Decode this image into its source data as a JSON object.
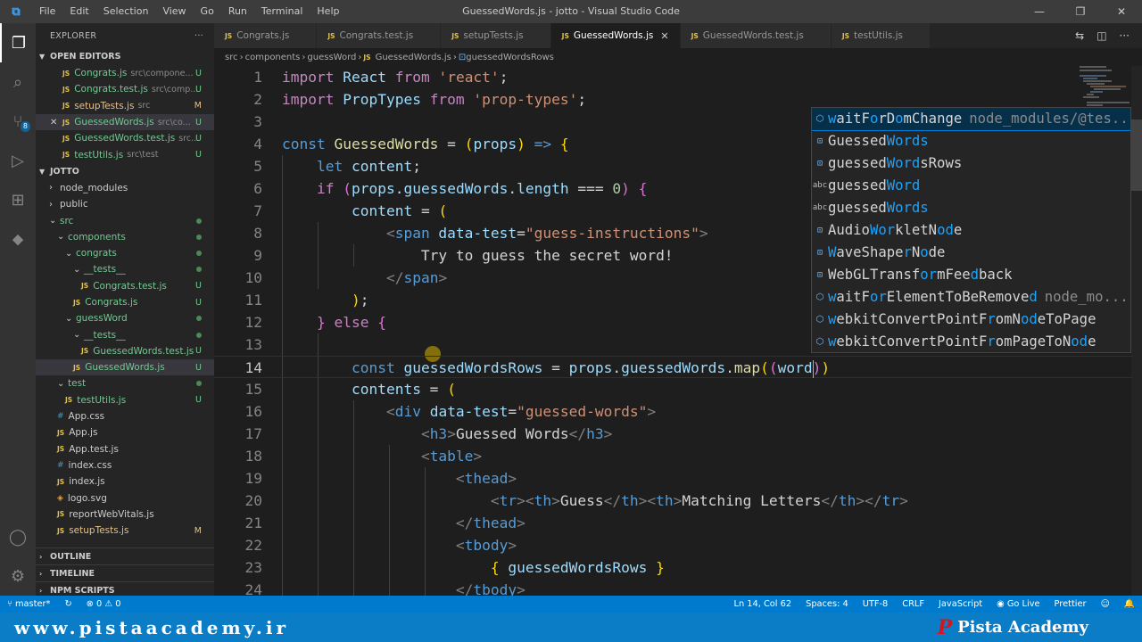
{
  "titlebar": {
    "menu": [
      "File",
      "Edit",
      "Selection",
      "View",
      "Go",
      "Run",
      "Terminal",
      "Help"
    ],
    "title": "GuessedWords.js - jotto - Visual Studio Code"
  },
  "explorer": {
    "title": "EXPLORER",
    "open_editors_label": "OPEN EDITORS",
    "open_editors": [
      {
        "name": "Congrats.js",
        "dir": "src\\compone...",
        "status": "U"
      },
      {
        "name": "Congrats.test.js",
        "dir": "src\\comp...",
        "status": "U"
      },
      {
        "name": "setupTests.js",
        "dir": "src",
        "status": "M"
      },
      {
        "name": "GuessedWords.js",
        "dir": "src\\co...",
        "status": "U"
      },
      {
        "name": "GuessedWords.test.js",
        "dir": "src...",
        "status": "U"
      },
      {
        "name": "testUtils.js",
        "dir": "src\\test",
        "status": "U"
      }
    ],
    "project_label": "JOTTO",
    "tree": [
      {
        "name": "node_modules",
        "type": "folder",
        "indent": 1,
        "open": false
      },
      {
        "name": "public",
        "type": "folder",
        "indent": 1,
        "open": false
      },
      {
        "name": "src",
        "type": "folder",
        "indent": 1,
        "open": true
      },
      {
        "name": "components",
        "type": "folder",
        "indent": 2,
        "open": true
      },
      {
        "name": "congrats",
        "type": "folder",
        "indent": 3,
        "open": true
      },
      {
        "name": "__tests__",
        "type": "folder",
        "indent": 4,
        "open": true
      },
      {
        "name": "Congrats.test.js",
        "type": "js",
        "indent": 5,
        "status": "U"
      },
      {
        "name": "Congrats.js",
        "type": "js",
        "indent": 4,
        "status": "U"
      },
      {
        "name": "guessWord",
        "type": "folder",
        "indent": 3,
        "open": true
      },
      {
        "name": "__tests__",
        "type": "folder",
        "indent": 4,
        "open": true
      },
      {
        "name": "GuessedWords.test.js",
        "type": "js",
        "indent": 5,
        "status": "U"
      },
      {
        "name": "GuessedWords.js",
        "type": "js",
        "indent": 4,
        "status": "U",
        "selected": true
      },
      {
        "name": "test",
        "type": "folder",
        "indent": 2,
        "open": true
      },
      {
        "name": "testUtils.js",
        "type": "js",
        "indent": 3,
        "status": "U"
      },
      {
        "name": "App.css",
        "type": "css",
        "indent": 2
      },
      {
        "name": "App.js",
        "type": "js",
        "indent": 2
      },
      {
        "name": "App.test.js",
        "type": "js",
        "indent": 2
      },
      {
        "name": "index.css",
        "type": "css",
        "indent": 2
      },
      {
        "name": "index.js",
        "type": "js",
        "indent": 2
      },
      {
        "name": "logo.svg",
        "type": "svg",
        "indent": 2
      },
      {
        "name": "reportWebVitals.js",
        "type": "js",
        "indent": 2
      },
      {
        "name": "setupTests.js",
        "type": "js",
        "indent": 2,
        "status": "M"
      }
    ],
    "outline_label": "OUTLINE",
    "timeline_label": "TIMELINE",
    "npm_label": "NPM SCRIPTS"
  },
  "tabs": [
    "Congrats.js",
    "Congrats.test.js",
    "setupTests.js",
    "GuessedWords.js",
    "GuessedWords.test.js",
    "testUtils.js"
  ],
  "active_tab": 3,
  "breadcrumb": [
    "src",
    "components",
    "guessWord",
    "GuessedWords.js",
    "guessedWordsRows"
  ],
  "code": [
    {
      "n": "1",
      "t": [
        [
          "import",
          "c"
        ],
        [
          " React ",
          "v"
        ],
        [
          "from",
          "c"
        ],
        [
          " ",
          ""
        ],
        [
          "'react'",
          "s"
        ],
        [
          ";",
          "p"
        ]
      ]
    },
    {
      "n": "2",
      "t": [
        [
          "import",
          "c"
        ],
        [
          " PropTypes ",
          "v"
        ],
        [
          "from",
          "c"
        ],
        [
          " ",
          ""
        ],
        [
          "'prop-types'",
          "s"
        ],
        [
          ";",
          "p"
        ]
      ]
    },
    {
      "n": "3",
      "t": []
    },
    {
      "n": "4",
      "t": [
        [
          "const",
          "k"
        ],
        [
          " ",
          ""
        ],
        [
          "GuessedWords",
          "f"
        ],
        [
          " = ",
          "p"
        ],
        [
          "(",
          "y"
        ],
        [
          "props",
          "v"
        ],
        [
          ")",
          "y"
        ],
        [
          " => ",
          "k"
        ],
        [
          "{",
          "y"
        ]
      ]
    },
    {
      "n": "5",
      "t": [
        [
          "    ",
          ""
        ],
        [
          "let",
          "k"
        ],
        [
          " content",
          "v"
        ],
        [
          ";",
          "p"
        ]
      ]
    },
    {
      "n": "6",
      "t": [
        [
          "    ",
          ""
        ],
        [
          "if",
          "c"
        ],
        [
          " ",
          ""
        ],
        [
          "(",
          "m"
        ],
        [
          "props",
          "v"
        ],
        [
          ".",
          "p"
        ],
        [
          "guessedWords",
          "v"
        ],
        [
          ".",
          "p"
        ],
        [
          "length",
          "v"
        ],
        [
          " === ",
          "p"
        ],
        [
          "0",
          "n"
        ],
        [
          ")",
          "m"
        ],
        [
          " ",
          ""
        ],
        [
          "{",
          "m"
        ]
      ]
    },
    {
      "n": "7",
      "t": [
        [
          "        ",
          ""
        ],
        [
          "content",
          "v"
        ],
        [
          " = ",
          "p"
        ],
        [
          "(",
          "y"
        ]
      ]
    },
    {
      "n": "8",
      "t": [
        [
          "            ",
          ""
        ],
        [
          "<",
          "g"
        ],
        [
          "span",
          "k"
        ],
        [
          " data-test",
          "v"
        ],
        [
          "=",
          "p"
        ],
        [
          "\"guess-instructions\"",
          "s"
        ],
        [
          ">",
          "g"
        ]
      ]
    },
    {
      "n": "9",
      "t": [
        [
          "                Try to guess the secret word!",
          "p"
        ]
      ]
    },
    {
      "n": "10",
      "t": [
        [
          "            ",
          ""
        ],
        [
          "</",
          "g"
        ],
        [
          "span",
          "k"
        ],
        [
          ">",
          "g"
        ]
      ]
    },
    {
      "n": "11",
      "t": [
        [
          "        ",
          ""
        ],
        [
          ")",
          "y"
        ],
        [
          ";",
          "p"
        ]
      ]
    },
    {
      "n": "12",
      "t": [
        [
          "    ",
          ""
        ],
        [
          "}",
          "m"
        ],
        [
          " ",
          ""
        ],
        [
          "else",
          "c"
        ],
        [
          " ",
          ""
        ],
        [
          "{",
          "m"
        ]
      ]
    },
    {
      "n": "13",
      "t": []
    },
    {
      "n": "14",
      "t": [
        [
          "        ",
          ""
        ],
        [
          "const",
          "k"
        ],
        [
          " ",
          ""
        ],
        [
          "guessedWordsRows",
          "v"
        ],
        [
          " = ",
          "p"
        ],
        [
          "props",
          "v"
        ],
        [
          ".",
          "p"
        ],
        [
          "guessedWords",
          "v"
        ],
        [
          ".",
          "p"
        ],
        [
          "map",
          "f"
        ],
        [
          "(",
          "y"
        ],
        [
          "(",
          "m"
        ],
        [
          "word",
          "v"
        ],
        [
          ")",
          "m"
        ],
        [
          ")",
          "y"
        ]
      ]
    },
    {
      "n": "15",
      "t": [
        [
          "        ",
          ""
        ],
        [
          "contents",
          "v"
        ],
        [
          " = ",
          "p"
        ],
        [
          "(",
          "y"
        ]
      ]
    },
    {
      "n": "16",
      "t": [
        [
          "            ",
          ""
        ],
        [
          "<",
          "g"
        ],
        [
          "div",
          "k"
        ],
        [
          " data-test",
          "v"
        ],
        [
          "=",
          "p"
        ],
        [
          "\"guessed-words\"",
          "s"
        ],
        [
          ">",
          "g"
        ]
      ]
    },
    {
      "n": "17",
      "t": [
        [
          "                ",
          ""
        ],
        [
          "<",
          "g"
        ],
        [
          "h3",
          "k"
        ],
        [
          ">",
          "g"
        ],
        [
          "Guessed Words",
          "p"
        ],
        [
          "</",
          "g"
        ],
        [
          "h3",
          "k"
        ],
        [
          ">",
          "g"
        ]
      ]
    },
    {
      "n": "18",
      "t": [
        [
          "                ",
          ""
        ],
        [
          "<",
          "g"
        ],
        [
          "table",
          "k"
        ],
        [
          ">",
          "g"
        ]
      ]
    },
    {
      "n": "19",
      "t": [
        [
          "                    ",
          ""
        ],
        [
          "<",
          "g"
        ],
        [
          "thead",
          "k"
        ],
        [
          ">",
          "g"
        ]
      ]
    },
    {
      "n": "20",
      "t": [
        [
          "                        ",
          ""
        ],
        [
          "<",
          "g"
        ],
        [
          "tr",
          "k"
        ],
        [
          "><",
          "g"
        ],
        [
          "th",
          "k"
        ],
        [
          ">",
          "g"
        ],
        [
          "Guess",
          "p"
        ],
        [
          "</",
          "g"
        ],
        [
          "th",
          "k"
        ],
        [
          "><",
          "g"
        ],
        [
          "th",
          "k"
        ],
        [
          ">",
          "g"
        ],
        [
          "Matching Letters",
          "p"
        ],
        [
          "</",
          "g"
        ],
        [
          "th",
          "k"
        ],
        [
          "></",
          "g"
        ],
        [
          "tr",
          "k"
        ],
        [
          ">",
          "g"
        ]
      ]
    },
    {
      "n": "21",
      "t": [
        [
          "                    ",
          ""
        ],
        [
          "</",
          "g"
        ],
        [
          "thead",
          "k"
        ],
        [
          ">",
          "g"
        ]
      ]
    },
    {
      "n": "22",
      "t": [
        [
          "                    ",
          ""
        ],
        [
          "<",
          "g"
        ],
        [
          "tbody",
          "k"
        ],
        [
          ">",
          "g"
        ]
      ]
    },
    {
      "n": "23",
      "t": [
        [
          "                        ",
          ""
        ],
        [
          "{",
          "y"
        ],
        [
          " guessedWordsRows ",
          "v"
        ],
        [
          "}",
          "y"
        ]
      ]
    },
    {
      "n": "24",
      "t": [
        [
          "                    ",
          ""
        ],
        [
          "</",
          "g"
        ],
        [
          "tbody",
          "k"
        ],
        [
          ">",
          "g"
        ]
      ]
    }
  ],
  "current_line": 14,
  "suggestions": [
    {
      "icon": "cube",
      "label": [
        [
          "w",
          1
        ],
        [
          "aitF",
          0
        ],
        [
          "o",
          1
        ],
        [
          "rD",
          0
        ],
        [
          "o",
          1
        ],
        [
          "mChange",
          0
        ]
      ],
      "detail": "node_modules/@tes...",
      "selected": true
    },
    {
      "icon": "var",
      "label": [
        [
          "Guessed",
          0
        ],
        [
          "Words",
          1
        ]
      ]
    },
    {
      "icon": "var",
      "label": [
        [
          "guessed",
          0
        ],
        [
          "Word",
          1
        ],
        [
          "sRows",
          0
        ]
      ]
    },
    {
      "icon": "abc",
      "label": [
        [
          "guessed",
          0
        ],
        [
          "Word",
          1
        ]
      ]
    },
    {
      "icon": "abc",
      "label": [
        [
          "guessed",
          0
        ],
        [
          "Words",
          1
        ]
      ]
    },
    {
      "icon": "var",
      "label": [
        [
          "Audio",
          0
        ],
        [
          "Wor",
          1
        ],
        [
          "kletN",
          0
        ],
        [
          "od",
          1
        ],
        [
          "e",
          0
        ]
      ]
    },
    {
      "icon": "var",
      "label": [
        [
          "W",
          1
        ],
        [
          "aveShape",
          0
        ],
        [
          "r",
          1
        ],
        [
          "N",
          0
        ],
        [
          "o",
          1
        ],
        [
          "de",
          0
        ]
      ]
    },
    {
      "icon": "var",
      "label": [
        [
          "WebGLTransf",
          0
        ],
        [
          "or",
          1
        ],
        [
          "mFee",
          0
        ],
        [
          "d",
          1
        ],
        [
          "back",
          0
        ]
      ]
    },
    {
      "icon": "cube",
      "label": [
        [
          "w",
          1
        ],
        [
          "aitF",
          0
        ],
        [
          "or",
          1
        ],
        [
          "ElementToBeRemove",
          0
        ],
        [
          "d",
          1
        ]
      ],
      "detail": "node_mo..."
    },
    {
      "icon": "cube",
      "label": [
        [
          "w",
          1
        ],
        [
          "ebkitConvertPointF",
          0
        ],
        [
          "r",
          1
        ],
        [
          "omN",
          0
        ],
        [
          "od",
          1
        ],
        [
          "eToPage",
          0
        ]
      ]
    },
    {
      "icon": "cube",
      "label": [
        [
          "w",
          1
        ],
        [
          "ebkitConvertPointF",
          0
        ],
        [
          "r",
          1
        ],
        [
          "omPageToN",
          0
        ],
        [
          "od",
          1
        ],
        [
          "e",
          0
        ]
      ]
    }
  ],
  "status": {
    "branch": "master*",
    "problems": "0",
    "warnings": "0",
    "position": "Ln 14, Col 62",
    "spaces": "Spaces: 4",
    "encoding": "UTF-8",
    "eol": "CRLF",
    "language": "JavaScript",
    "golive": "Go Live",
    "prettier": "Prettier"
  },
  "watermark": {
    "url": "www.pistaacademy.ir",
    "brand": "Pista Academy",
    "logo_letter": "P"
  },
  "colors": {
    "accent": "#007acc",
    "keyword": "#569cd6",
    "string": "#ce9178",
    "variable": "#9cdcfe"
  }
}
